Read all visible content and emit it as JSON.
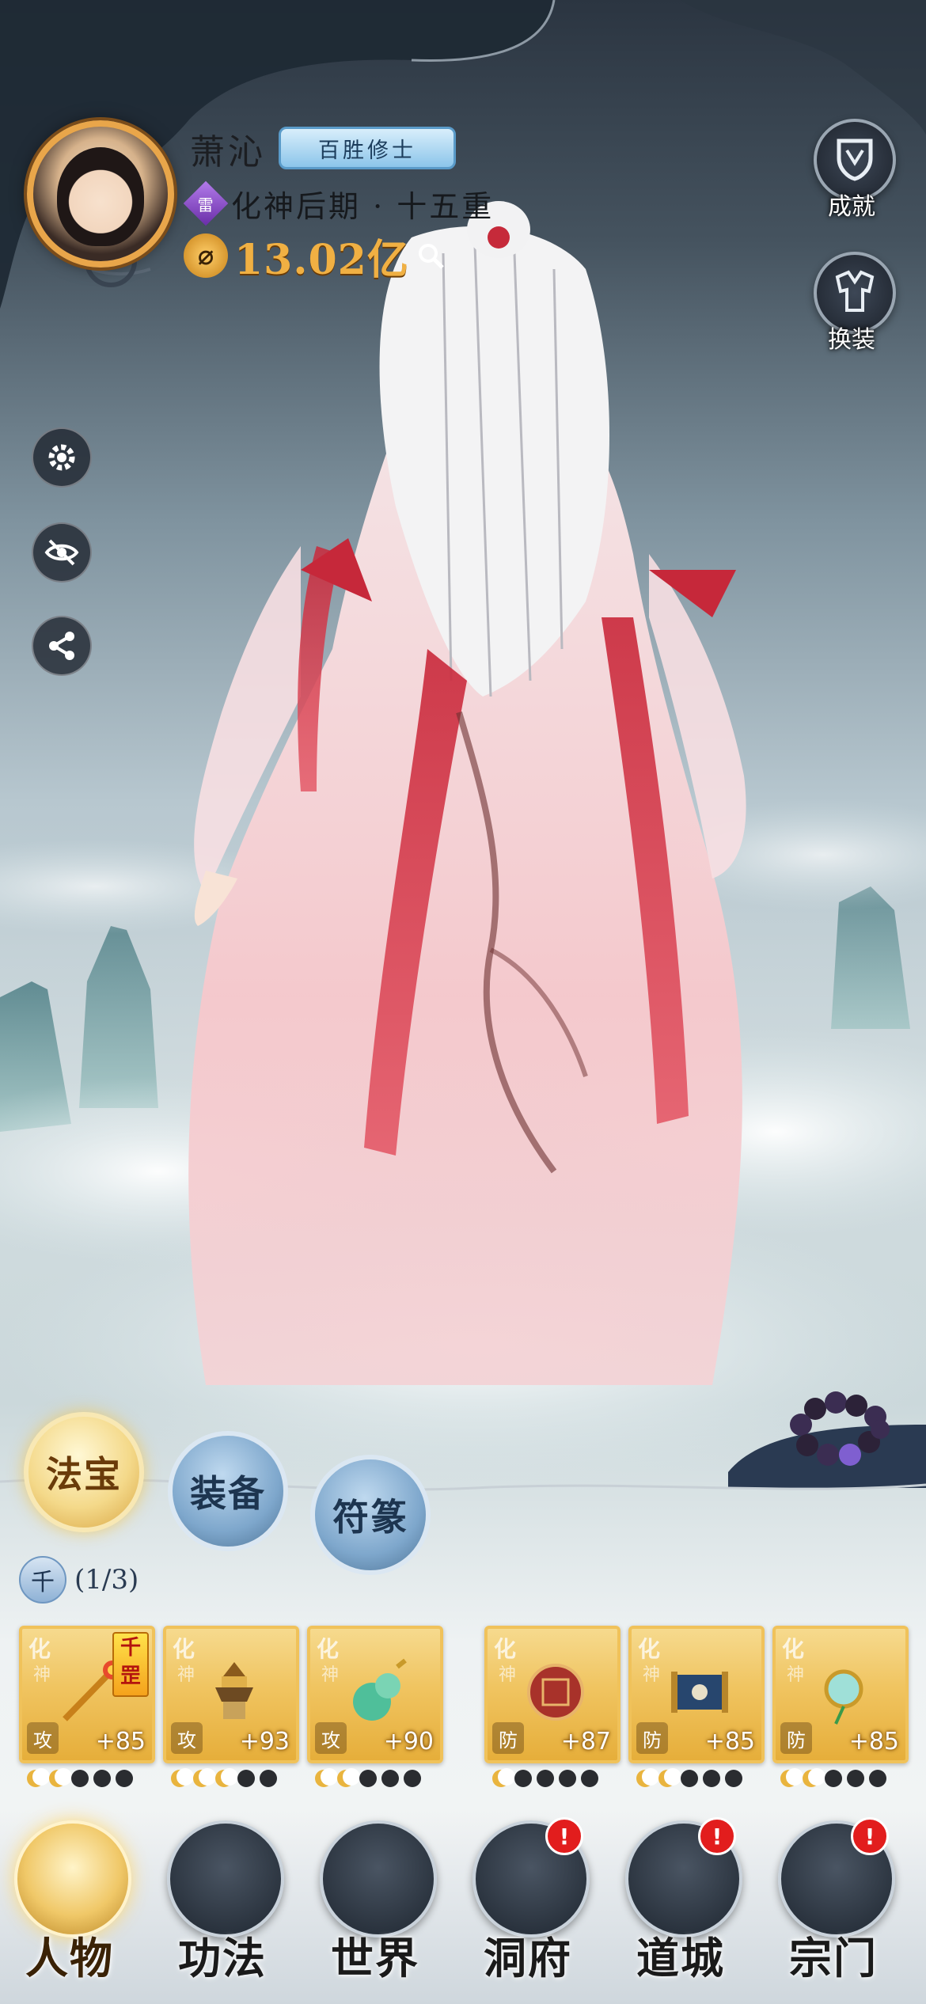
{
  "player": {
    "name": "萧沁",
    "title_badge": "百胜修士",
    "element_tag": "雷",
    "realm": "化神后期 · 十五重",
    "power_icon": "⌀",
    "combat_power": "13.02亿"
  },
  "right_buttons": {
    "achievement_label": "成就",
    "outfit_label": "换装"
  },
  "side_buttons": [
    "settings-icon",
    "hide-icon",
    "share-icon"
  ],
  "tabs": {
    "fabao": "法宝",
    "zhuangbei": "装备",
    "fulu": "符篆"
  },
  "set": {
    "chip": "千",
    "count": "(1/3)"
  },
  "cards": [
    {
      "realm": "化",
      "realm2": "神",
      "type": "攻",
      "plus": "+85",
      "tag": "千罡",
      "moons_lit": 2,
      "item": "golden-staff"
    },
    {
      "realm": "化",
      "realm2": "神",
      "type": "攻",
      "plus": "+93",
      "tag": "",
      "moons_lit": 3,
      "item": "pagoda-bell"
    },
    {
      "realm": "化",
      "realm2": "神",
      "type": "攻",
      "plus": "+90",
      "tag": "",
      "moons_lit": 2,
      "item": "jade-gourd"
    },
    {
      "realm": "化",
      "realm2": "神",
      "type": "防",
      "plus": "+87",
      "tag": "",
      "moons_lit": 1,
      "item": "red-orb"
    },
    {
      "realm": "化",
      "realm2": "神",
      "type": "防",
      "plus": "+85",
      "tag": "",
      "moons_lit": 2,
      "item": "scroll"
    },
    {
      "realm": "化",
      "realm2": "神",
      "type": "防",
      "plus": "+85",
      "tag": "",
      "moons_lit": 2,
      "item": "jade-pendant"
    }
  ],
  "nav": [
    {
      "label": "人物",
      "badge": ""
    },
    {
      "label": "功法",
      "badge": ""
    },
    {
      "label": "世界",
      "badge": ""
    },
    {
      "label": "洞府",
      "badge": "!"
    },
    {
      "label": "道城",
      "badge": "!"
    },
    {
      "label": "宗门",
      "badge": "!"
    }
  ],
  "colors": {
    "gold": "#f0b043",
    "badge_blue": "#8cc5ea",
    "card_gold": "#f0c460",
    "alert_red": "#e21d1d"
  }
}
